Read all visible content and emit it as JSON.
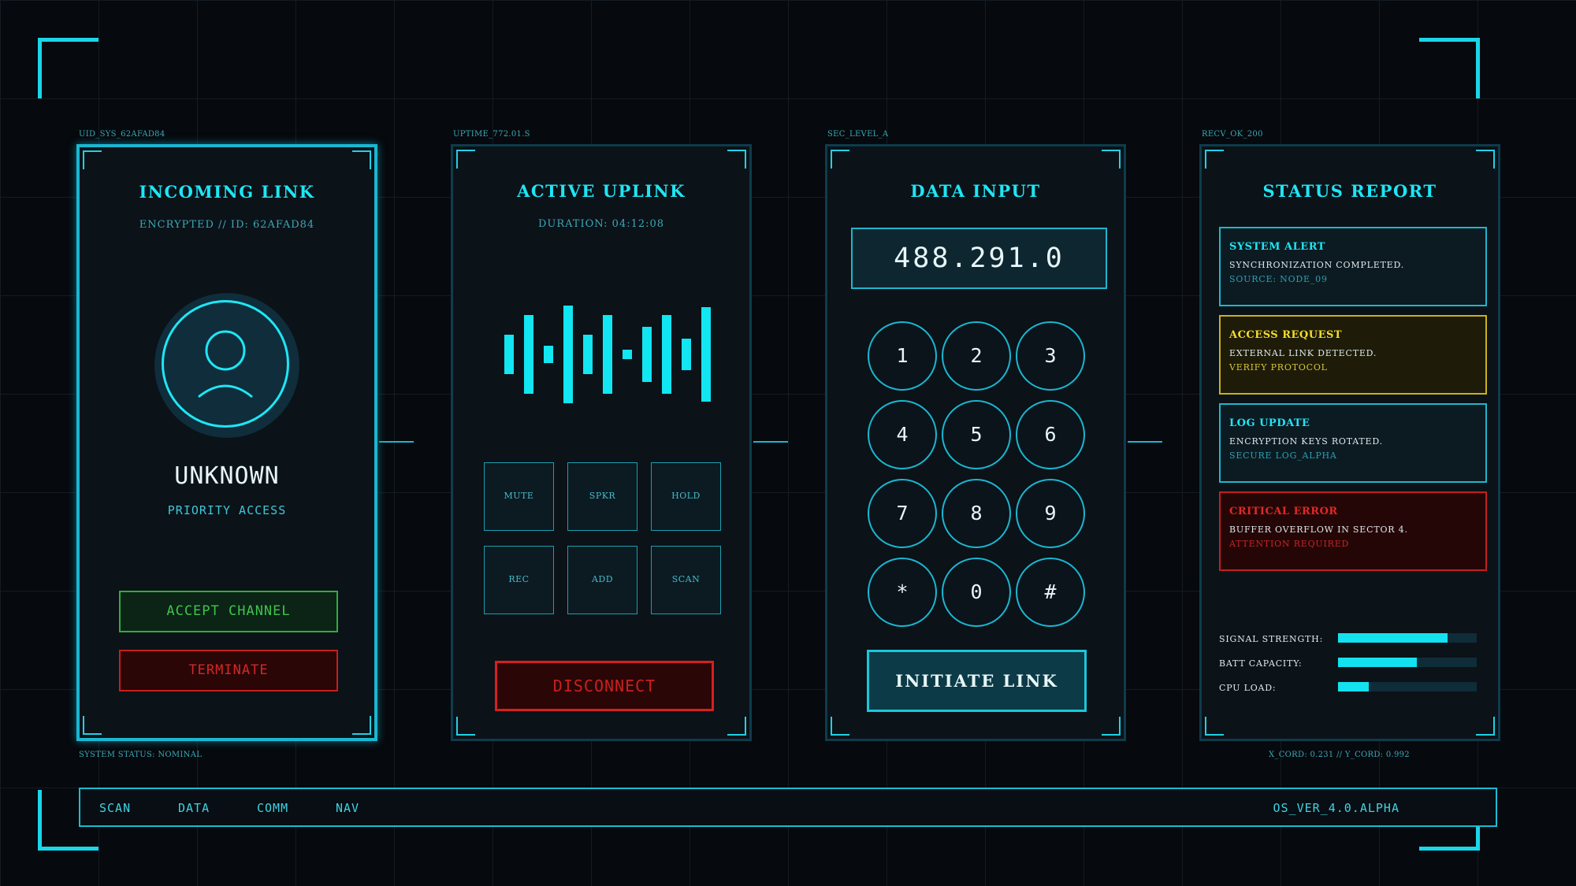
{
  "headers": {
    "p1": "UID_SYS_62AFAD84",
    "p2": "UPTIME_772.01.S",
    "p3": "SEC_LEVEL_A",
    "p4": "RECV_OK_200"
  },
  "footers": {
    "left": "SYSTEM STATUS: NOMINAL",
    "right": "X_CORD: 0.231 // Y_CORD: 0.992"
  },
  "incoming": {
    "title": "INCOMING LINK",
    "subtitle": "ENCRYPTED // ID: 62AFAD84",
    "avatar_icon": "user-icon",
    "caller": "UNKNOWN",
    "access": "PRIORITY ACCESS",
    "accept_label": "ACCEPT CHANNEL",
    "terminate_label": "TERMINATE"
  },
  "uplink": {
    "title": "ACTIVE UPLINK",
    "duration": "DURATION: 04:12:08",
    "waveform_icon": "waveform-icon",
    "controls": [
      "MUTE",
      "SPKR",
      "HOLD",
      "REC",
      "ADD",
      "SCAN"
    ],
    "disconnect_label": "DISCONNECT"
  },
  "data_input": {
    "title": "DATA INPUT",
    "display_value": "488.291.0",
    "keys": [
      "1",
      "2",
      "3",
      "4",
      "5",
      "6",
      "7",
      "8",
      "9",
      "*",
      "0",
      "#"
    ],
    "initiate_label": "INITIATE LINK"
  },
  "status": {
    "title": "STATUS REPORT",
    "cards": [
      {
        "title": "SYSTEM ALERT",
        "line1": "SYNCHRONIZATION COMPLETED.",
        "line2": "SOURCE: NODE_09",
        "color": "#1fb6cc",
        "bg": "#0c1b22",
        "title_color": "#1ee6f5",
        "line2_color": "#2d9fb2"
      },
      {
        "title": "ACCESS REQUEST",
        "line1": "EXTERNAL LINK DETECTED.",
        "line2": "VERIFY PROTOCOL",
        "color": "#c9b21b",
        "bg": "#1e1c08",
        "title_color": "#f4dd2a",
        "line2_color": "#d8c43a"
      },
      {
        "title": "LOG UPDATE",
        "line1": "ENCRYPTION KEYS ROTATED.",
        "line2": "SECURE LOG_ALPHA",
        "color": "#1fb6cc",
        "bg": "#0c1b22",
        "title_color": "#1ee6f5",
        "line2_color": "#2d9fb2"
      },
      {
        "title": "CRITICAL ERROR",
        "line1": "BUFFER OVERFLOW IN SECTOR 4.",
        "line2": "ATTENTION REQUIRED",
        "color": "#c41f1f",
        "bg": "#250606",
        "title_color": "#e12828",
        "line2_color": "#c52525"
      }
    ],
    "meters": [
      {
        "label": "SIGNAL STRENGTH:",
        "value": 0.79
      },
      {
        "label": "BATT CAPACITY:",
        "value": 0.57
      },
      {
        "label": "CPU LOAD:",
        "value": 0.22
      }
    ]
  },
  "nav": {
    "items": [
      "SCAN",
      "DATA",
      "COMM",
      "NAV"
    ],
    "version": "OS_VER_4.0.ALPHA"
  },
  "colors": {
    "accent": "#1ee6f5",
    "danger": "#d32828",
    "success": "#3fc34c",
    "warning": "#f4dd2a",
    "background": "#06090d"
  }
}
